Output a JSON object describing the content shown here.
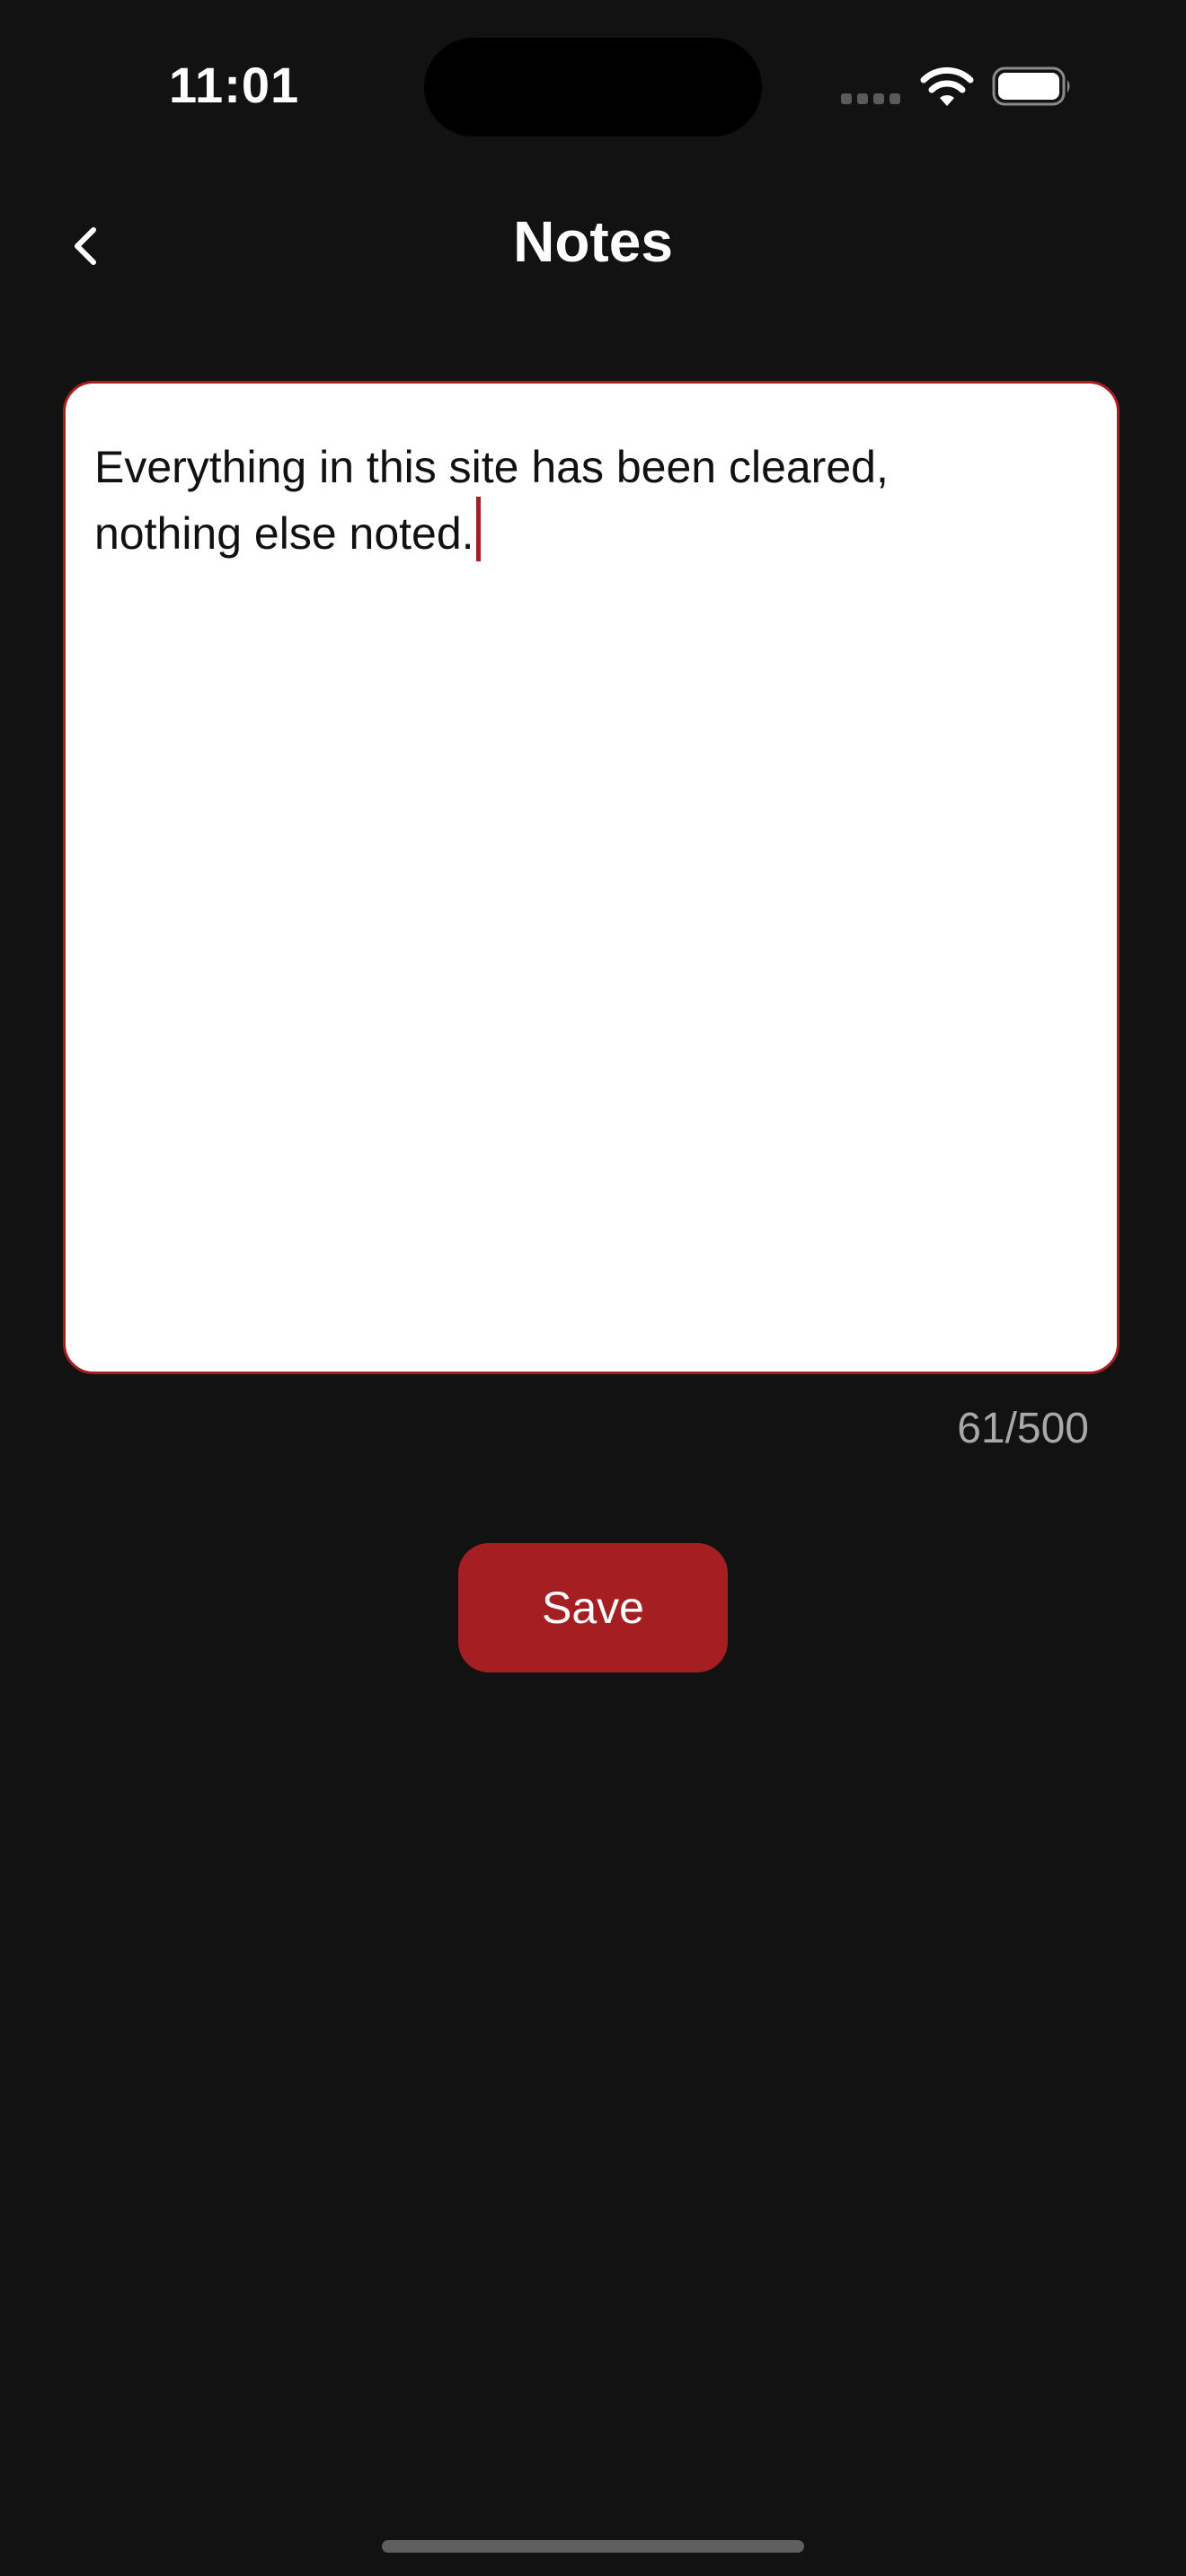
{
  "status_bar": {
    "time": "11:01",
    "icons": [
      "cellular-signal-icon",
      "wifi-icon",
      "battery-icon"
    ]
  },
  "header": {
    "back_icon": "chevron-left-icon",
    "title": "Notes"
  },
  "notes": {
    "line1": "Everything in this site has been cleared,",
    "line2": "nothing else noted.",
    "counter": "61/500"
  },
  "actions": {
    "save_label": "Save"
  },
  "colors": {
    "background": "#121212",
    "accent": "#a51e22",
    "text_primary": "#ffffff",
    "counter_text": "#a8a8a8"
  }
}
